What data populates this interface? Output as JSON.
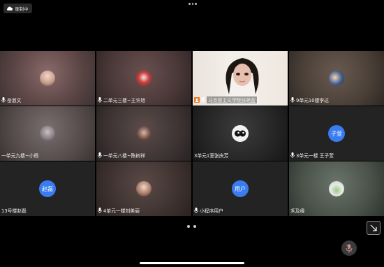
{
  "recording_badge": {
    "label": "录制中"
  },
  "tiles": [
    {
      "name": "岳淑文"
    },
    {
      "name": "二单元三楼~王许旭"
    },
    {
      "name": "马克思主义学院张艳蓝"
    },
    {
      "name": "9单元10楼李达"
    },
    {
      "name": "一单元九楼~小杨"
    },
    {
      "name": "一单元八楼~陈树祥"
    },
    {
      "name": "3单元1室张庆芳"
    },
    {
      "name": "3单元一楼 王子萱",
      "avatar_text": "子萱"
    },
    {
      "name": "13号楼赵磊",
      "avatar_text": "赵磊"
    },
    {
      "name": "4单元一楼刘美丽"
    },
    {
      "name": "小程序用户",
      "avatar_text": "用户"
    },
    {
      "name": "禾及缘"
    }
  ],
  "colors": {
    "avatar_blue": "#3a7bf0",
    "active_speaker": "#36c36b"
  }
}
